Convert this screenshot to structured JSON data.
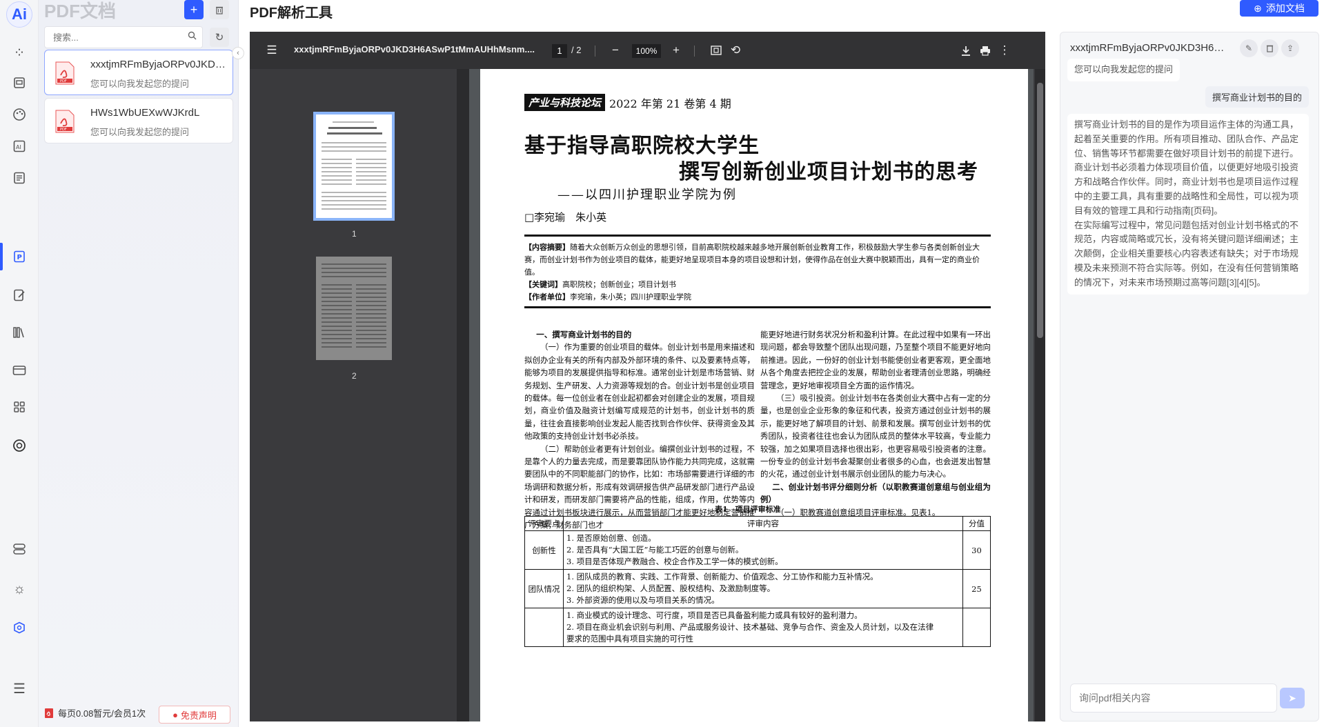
{
  "rail": {
    "logo_text": "Ai",
    "icons": [
      "grid-dots-icon",
      "file-list-icon",
      "palette-icon",
      "ai-box-icon",
      "document-icon",
      "pdf-p-icon",
      "edit-note-icon",
      "library-icon",
      "video-card-icon",
      "apps-icon",
      "openai-icon",
      "storage-icon",
      "sun-icon",
      "hexagon-icon",
      "menu-collapse-icon"
    ]
  },
  "docpanel": {
    "title": "PDF文档",
    "search_placeholder": "搜索...",
    "docs": [
      {
        "name": "xxxtjmRFmByjaORPv0JKD3H6ASwP1tMmAUHhMsnm",
        "subtitle": "您可以向我发起您的提问"
      },
      {
        "name": "HWs1WbUEXwWJKrdL",
        "subtitle": "您可以向我发起您的提问"
      }
    ],
    "fee_text": "每页0.08暂元/会员1次",
    "disclaimer": "免责声明"
  },
  "header": {
    "title": "PDF解析工具",
    "add_doc": "添加文档"
  },
  "viewer": {
    "filename": "xxxtjmRFmByjaORPv0JKD3H6ASwP1tMmAUHhMsnm....",
    "current_page": "1",
    "total_pages": "/ 2",
    "zoom": "100%",
    "thumb_labels": [
      "1",
      "2"
    ],
    "page": {
      "journal_logo": "产业与科技论坛",
      "journal_issue": "2022 年第 21 卷第 4 期",
      "title_line1": "基于指导高职院校大学生",
      "title_line2": "撰写创新创业项目计划书的思考",
      "subtitle": "——以四川护理职业学院为例",
      "authors": "□李宛瑜　朱小英",
      "abstract_label": "【内容摘要】",
      "abstract_text": "随着大众创新万众创业的思想引领，目前高职院校越来越多地开展创新创业教育工作，积极鼓励大学生参与各类创新创业大赛，而创业计划书作为创业项目的载体，能更好地呈现项目本身的项目设想和计划，使得作品在创业大赛中脱颖而出，具有一定的商业价值。",
      "keywords_label": "【关键词】",
      "keywords_text": "高职院校；创新创业；项目计划书",
      "unit_label": "【作者单位】",
      "unit_text": "李宛瑜，朱小英；四川护理职业学院",
      "left_col": [
        {
          "type": "h",
          "text": "一、撰写商业计划书的目的"
        },
        {
          "type": "p",
          "text": "（一）作为重要的创业项目的载体。创业计划书是用来描述和拟创办企业有关的所有内部及外部环境的条件、以及要素特点等，能够为项目的发展提供指导和标准。通常创业计划是市场营销、财务规划、生产研发、人力资源等规划的合。创业计划书是创业项目的载体。每一位创业者在创业起初都会对创建企业的发展，项目规划，商业价值及融资计划编写成规范的计划书，创业计划书的质量，往往会直接影响创业发起人能否找到合作伙伴、获得资金及其他政策的支持创业计划书必杀技。"
        },
        {
          "type": "p",
          "text": "（二）帮助创业者更有计划创业。编撰创业计划书的过程，不是靠个人的力量去完成，而是要靠团队协作能力共同完成，这就需要团队中的不同职能部门的协作，比如：市场部需要进行详细的市场调研和数据分析，形成有效调研报告供产品研发部门进行产品设计和研发，而研发部门需要将产品的性能，组成，作用，优势等内容通过计划书板块进行展示，从而营销部门才能更好地制定营销推广方案，财务部门也才"
        }
      ],
      "right_col": [
        {
          "type": "p0",
          "text": "能更好地进行财务状况分析和盈利计算。在此过程中如果有一环出现问题，都会导致整个团队出现问题，乃至整个项目不能更好地向前推进。因此，一份好的创业计划书能使创业者更客观，更全面地从各个角度去把控企业的发展，帮助创业者理清创业思路，明确经营理念，更好地审视项目全方面的运作情况。"
        },
        {
          "type": "p",
          "text": "（三）吸引投资。创业计划书在各类创业大赛中占有一定的分量，也是创业企业形象的象征和代表，投资方通过创业计划书的展示，能更好地了解项目的计划、前景和发展。撰写创业计划书的优秀团队，投资者往往也会认为团队成员的整体水平较高，专业能力较强，加之如果项目选择也很出彩，也更容易吸引投资者的注意。一份专业的创业计划书会凝聚创业者很多的心血，也会迸发出智慧的火花，通过创业计划书展示创业团队的能力与决心。"
        },
        {
          "type": "h",
          "text": "二、创业计划书评分细则分析（以职教赛道创意组与创业组为例）"
        },
        {
          "type": "p",
          "text": "（一）职教赛道创意组项目评审标准。见表1。"
        }
      ],
      "table_caption": "表1　项目评审标准",
      "table_headers": [
        "评审要点",
        "评审内容",
        "分值"
      ],
      "table_rows": [
        {
          "point": "创新性",
          "items": [
            "1. 是否原始创意、创造。",
            "2. 是否具有“大国工匠”与能工巧匠的创意与创新。",
            "3. 项目是否体现产教融合、校企合作及工学一体的模式创新。"
          ],
          "score": "30"
        },
        {
          "point": "团队情况",
          "items": [
            "1. 团队成员的教育、实践、工作背景、创新能力、价值观念、分工协作和能力互补情况。",
            "2. 团队的组织构架、人员配置、股权结构、及激励制度等。",
            "3. 外部资源的使用以及与项目关系的情况。"
          ],
          "score": "25"
        },
        {
          "point": "",
          "items": [
            "1. 商业模式的设计理念、可行度，项目是否已具备盈利能力或具有较好的盈利潜力。",
            "2. 项目在商业机会识别与利用、产品或服务设计、技术基础、竞争与合作、资金及人员计划，以及在法律",
            "要求的范围中具有项目实施的可行性"
          ],
          "score": ""
        }
      ]
    }
  },
  "chat": {
    "title": "xxxtjmRFmByjaORPv0JKD3H6ASwP1tMmAUHhMsnm",
    "greeting": "您可以向我发起您的提问",
    "user_question": "撰写商业计划书的目的",
    "answer_p1": "撰写商业计划书的目的是作为项目运作主体的沟通工具，起着至关重要的作用。所有项目推动、团队合作、产品定位、销售等环节都需要在做好项目计划书的前提下进行。商业计划书必须着力体现项目价值，以便更好地吸引投资方和战略合作伙伴。同时，商业计划书也是项目运作过程中的主要工具，具有重要的战略性和全局性，可以视为项目有效的管理工具和行动指南[页码]。",
    "answer_p2": "在实际编写过程中，常见问题包括对创业计划书格式的不规范，内容或简略或冗长，没有将关键问题详细阐述；主次颠倒，企业相关重要核心内容表述有缺失；对于市场规模及未来预测不符合实际等。例如，在没有任何营销策略的情况下，对未来市场预期过高等问题[3][4][5]。",
    "input_placeholder": "询问pdf相关内容"
  },
  "colors": {
    "accent": "#2f5bff",
    "viewer_bg": "#3a3a3d",
    "toolbar_bg": "#323234",
    "danger": "#e03b3b"
  }
}
